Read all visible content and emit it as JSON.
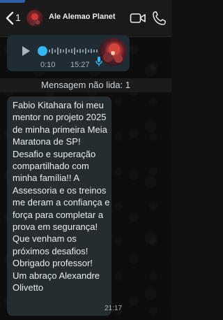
{
  "header": {
    "back_count": "1",
    "title": "Ale Alemao Planet",
    "icons": {
      "back": "chevron-left-icon",
      "video": "video-camera-icon",
      "call": "phone-icon"
    }
  },
  "voice_message": {
    "duration": "0:10",
    "time": "15:27",
    "progress": 0.0,
    "icons": {
      "play": "play-icon",
      "mic": "microphone-icon"
    }
  },
  "unread_banner": {
    "text": "Mensagem não lida: 1"
  },
  "message": {
    "text": "Fabio Kitahara foi meu mentor no projeto 2025 de minha primeira Meia Maratona de SP! Desafio e superação compartilhado com minha família!! A Assessoria e os treinos me deram a confiança e força para completar a prova em segurança! Que venham os próximos desafios! Obrigado professor!\nUm abraço Alexandre Olivetto",
    "time": "21:17"
  },
  "colors": {
    "accent": "#34b7f1",
    "bubble": "#262d31",
    "background": "#0d0d0d"
  }
}
